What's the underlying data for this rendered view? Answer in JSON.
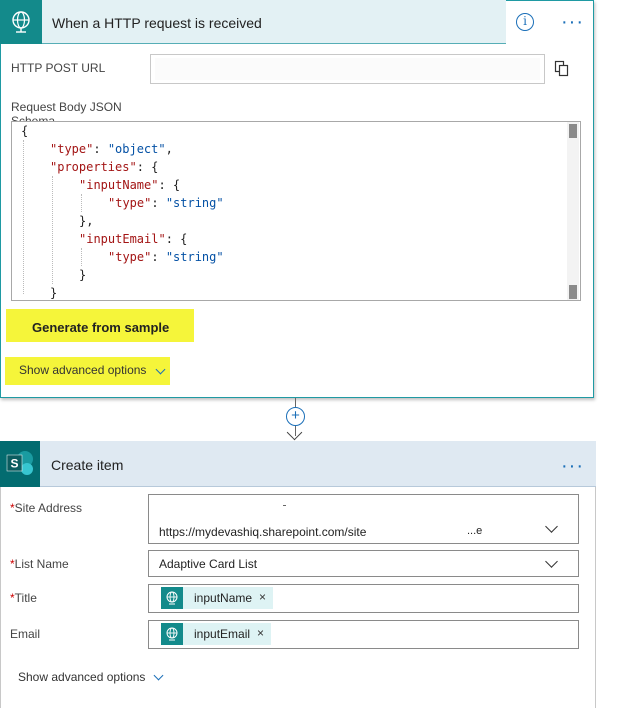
{
  "trigger": {
    "title": "When a HTTP request is received",
    "info_glyph": "i",
    "more_glyph": "···",
    "http_post_url_label": "HTTP POST URL",
    "http_post_url_value": "",
    "schema_label_line1": "Request Body JSON",
    "schema_label_line2": "Schema",
    "schema_code": {
      "l1": "{",
      "l2_key": "\"type\"",
      "l2_val": "\"object\"",
      "l3_key": "\"properties\"",
      "l4_key": "\"inputName\"",
      "l5_key": "\"type\"",
      "l5_val": "\"string\"",
      "l6": "},",
      "l7_key": "\"inputEmail\"",
      "l8_key": "\"type\"",
      "l8_val": "\"string\"",
      "l9": "}",
      "l10": "}"
    },
    "generate_button": "Generate from sample",
    "show_advanced": "Show advanced options"
  },
  "connector": {
    "plus_glyph": "+"
  },
  "create_item": {
    "title": "Create item",
    "more_glyph": "···",
    "required_mark": "*",
    "site_address_label": "Site Address",
    "site_address_value": "https://mydevashiq.sharepoint.com/site",
    "site_address_tail": "...e",
    "list_name_label": "List Name",
    "list_name_value": "Adaptive Card List",
    "title_label": "Title",
    "title_token": "inputName",
    "email_label": "Email",
    "email_token": "inputEmail",
    "token_remove_glyph": "×",
    "show_advanced": "Show advanced options"
  },
  "colors": {
    "trigger_accent": "#138a8b",
    "link_blue": "#1b6fb8",
    "highlight_yellow": "#f5f53a",
    "sharepoint_teal": "#036c70"
  }
}
